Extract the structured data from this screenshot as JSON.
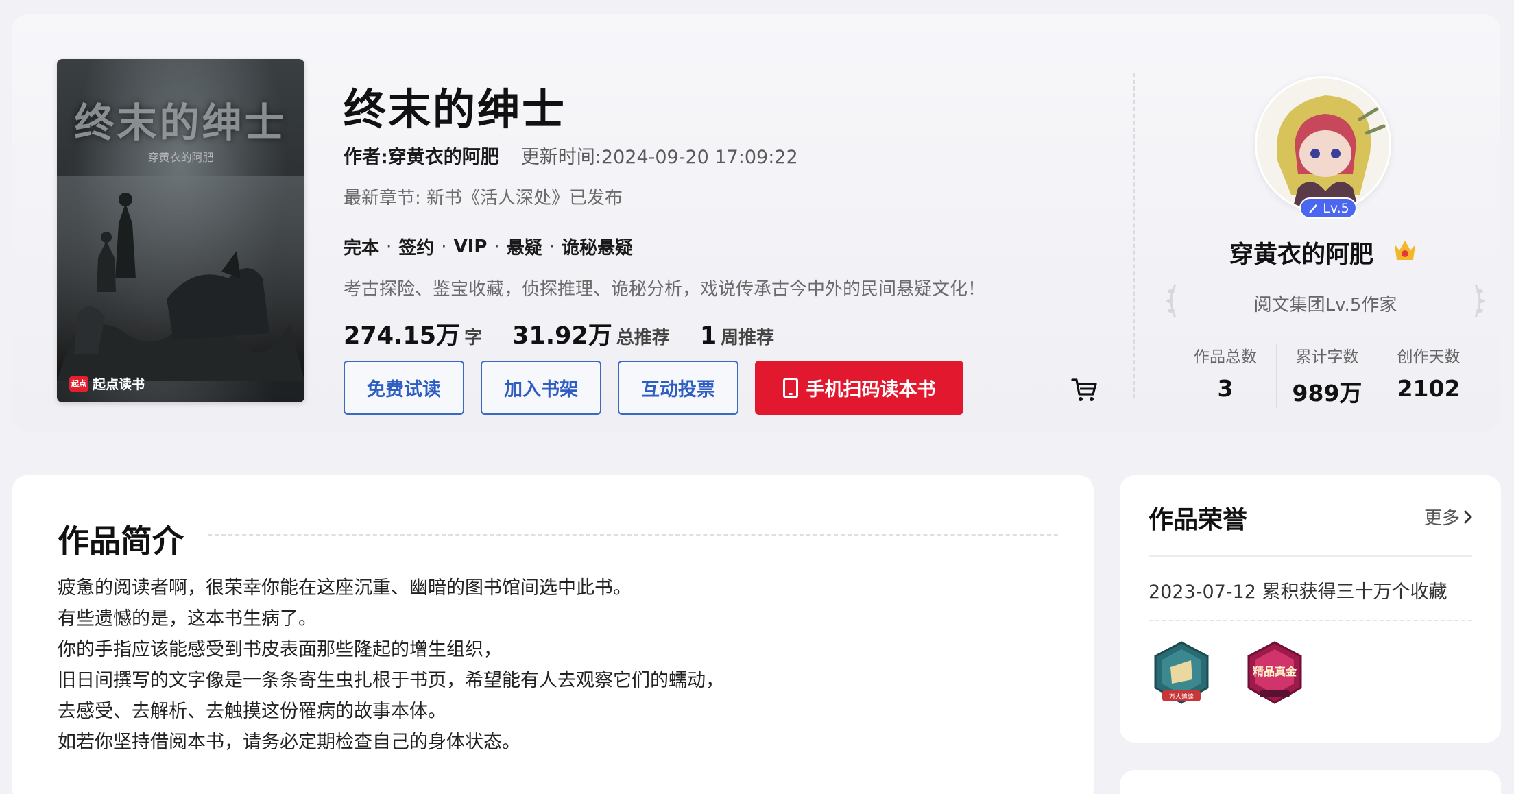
{
  "book": {
    "title": "终末的绅士",
    "cover_title": "终末的绅士",
    "cover_author": "穿黄衣的阿肥",
    "cover_brand_icon": "起点",
    "cover_brand": "起点读书",
    "author_line": "作者:穿黄衣的阿肥",
    "update_time": "更新时间:2024-09-20 17:09:22",
    "latest_chapter": "最新章节: 新书《活人深处》已发布",
    "tags": [
      "完本",
      "签约",
      "VIP",
      "悬疑",
      "诡秘悬疑"
    ],
    "tag_separator": "·",
    "description": "考古探险、鉴宝收藏，侦探推理、诡秘分析，戏说传承古今中外的民间悬疑文化！",
    "stats": [
      {
        "value": "274.15万",
        "unit": "字"
      },
      {
        "value": "31.92万",
        "unit": "总推荐"
      },
      {
        "value": "1",
        "unit": "周推荐"
      }
    ],
    "buttons": {
      "trial": "免费试读",
      "shelf": "加入书架",
      "vote": "互动投票",
      "scan": "手机扫码读本书"
    }
  },
  "author": {
    "name": "穿黄衣的阿肥",
    "level": "Lv.5",
    "title": "阅文集团Lv.5作家",
    "stats": [
      {
        "label": "作品总数",
        "value": "3"
      },
      {
        "label": "累计字数",
        "value": "989万"
      },
      {
        "label": "创作天数",
        "value": "2102"
      }
    ]
  },
  "intro": {
    "heading": "作品简介",
    "lines": [
      "疲惫的阅读者啊，很荣幸你能在这座沉重、幽暗的图书馆间选中此书。",
      "有些遗憾的是，这本书生病了。",
      "你的手指应该能感受到书皮表面那些隆起的增生组织，",
      "旧日间撰写的文字像是一条条寄生虫扎根于书页，希望能有人去观察它们的蠕动，",
      "去感受、去解析、去触摸这份罹病的故事本体。",
      "如若你坚持借阅本书，请务必定期检查自己的身体状态。"
    ]
  },
  "honors": {
    "heading": "作品荣誉",
    "more": "更多",
    "item": "2023-07-12 累积获得三十万个收藏",
    "medals": [
      "万人追读",
      "精品真金"
    ]
  },
  "colors": {
    "accent_blue": "#2f5ec2",
    "primary_red": "#e1182e",
    "level_blue": "#4b67f0"
  }
}
